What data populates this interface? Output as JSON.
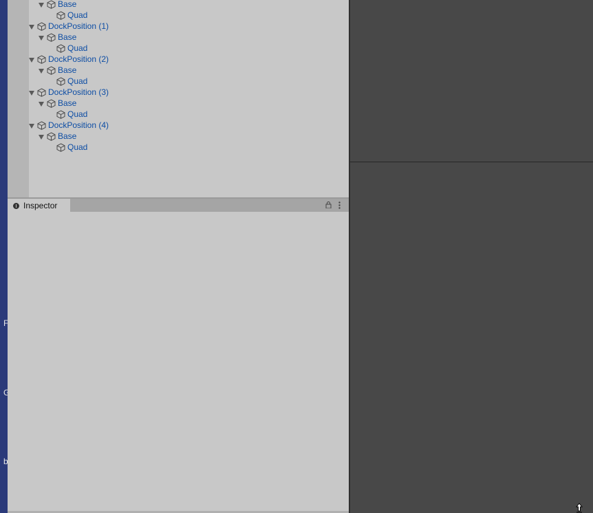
{
  "desktop_strip": {
    "letters": [
      "F",
      "G",
      "b"
    ]
  },
  "hierarchy": {
    "items": [
      {
        "label": "Base",
        "depth": 1,
        "expanded": true
      },
      {
        "label": "Quad",
        "depth": 2,
        "expanded": false
      },
      {
        "label": "DockPosition (1)",
        "depth": 0,
        "expanded": true
      },
      {
        "label": "Base",
        "depth": 1,
        "expanded": true
      },
      {
        "label": "Quad",
        "depth": 2,
        "expanded": false
      },
      {
        "label": "DockPosition (2)",
        "depth": 0,
        "expanded": true
      },
      {
        "label": "Base",
        "depth": 1,
        "expanded": true
      },
      {
        "label": "Quad",
        "depth": 2,
        "expanded": false
      },
      {
        "label": "DockPosition (3)",
        "depth": 0,
        "expanded": true
      },
      {
        "label": "Base",
        "depth": 1,
        "expanded": true
      },
      {
        "label": "Quad",
        "depth": 2,
        "expanded": false
      },
      {
        "label": "DockPosition (4)",
        "depth": 0,
        "expanded": true
      },
      {
        "label": "Base",
        "depth": 1,
        "expanded": true
      },
      {
        "label": "Quad",
        "depth": 2,
        "expanded": false
      }
    ]
  },
  "inspector": {
    "tab_label": "Inspector"
  },
  "colors": {
    "item_text": "#0d4da4",
    "panel_bg": "#c8c8c8",
    "scene_bg": "#484848",
    "desktop": "#2b3a7a"
  }
}
